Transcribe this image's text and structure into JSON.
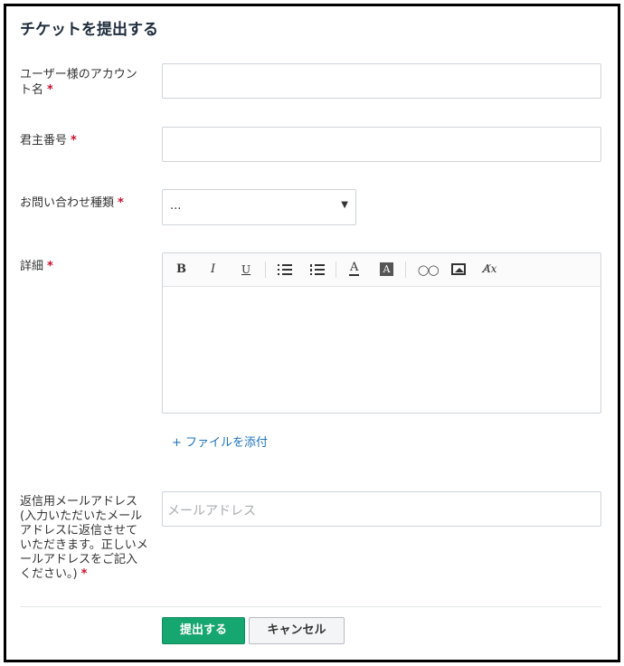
{
  "form": {
    "title": "チケットを提出する",
    "required_mark": "*",
    "fields": {
      "account_name": {
        "label": "ユーザー様のアカウント名",
        "value": ""
      },
      "lord_number": {
        "label": "君主番号",
        "value": ""
      },
      "inquiry_type": {
        "label": "お問い合わせ種類",
        "value": "..."
      },
      "details": {
        "label": "詳細",
        "value": ""
      },
      "reply_email": {
        "label": "返信用メールアドレス(入力いただいたメールアドレスに返信させていただきます。正しいメールアドレスをご記入ください。)",
        "placeholder": "メールアドレス",
        "value": ""
      }
    },
    "editor_toolbar": {
      "bold": "B",
      "italic": "I",
      "underline": "U",
      "bullet_list": "bulleted-list-icon",
      "numbered_list": "numbered-list-icon",
      "font_color": "A",
      "highlight": "A",
      "link": "link-icon",
      "image": "image-icon",
      "clear_format": "clear-formatting-icon"
    },
    "attach_label": "+ ファイルを添付",
    "submit_label": "提出する",
    "cancel_label": "キャンセル"
  },
  "colors": {
    "primary": "#16a66f",
    "link": "#1f73b7",
    "required": "#c8102e",
    "border": "#cfd4d9"
  }
}
